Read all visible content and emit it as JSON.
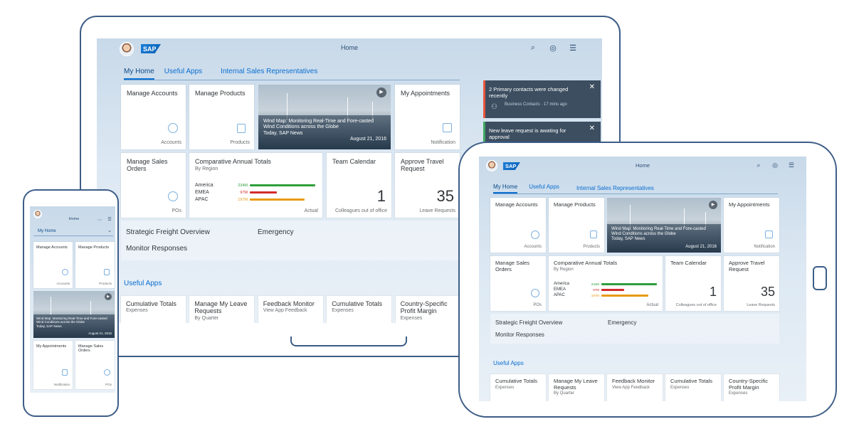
{
  "colors": {
    "accent": "#0a6ed1",
    "device_frame": "#3d5d87",
    "america": "#2f9e3b",
    "emea": "#d22b2b",
    "apac": "#e89a12"
  },
  "shell": {
    "title": "Home",
    "logo": "SAP",
    "search_icon": "search-icon",
    "copilot_icon": "copilot-icon",
    "menu_icon": "menu-icon"
  },
  "tabs": [
    "My Home",
    "Useful Apps",
    "Internal Sales Representatives"
  ],
  "tiles": {
    "manage_accounts": {
      "title": "Manage Accounts",
      "footer": "Accounts",
      "icon": "accounts-icon"
    },
    "manage_products": {
      "title": "Manage Products",
      "footer": "Products",
      "icon": "products-icon"
    },
    "news": {
      "headline": "Wind Map: Monitoring Real-Time and Fore-casted Wind Conditions across the Globe",
      "source": "Today, SAP News",
      "date": "August 21, 2016"
    },
    "my_appointments": {
      "title": "My Appointments",
      "footer": "Notification",
      "icon": "calendar-icon"
    },
    "manage_sales_orders": {
      "title": "Manage Sales Orders",
      "footer": "POs",
      "icon": "pos-icon"
    },
    "comparative": {
      "title": "Comparative Annual Totals",
      "subtitle": "By Region",
      "footer": "Actual"
    },
    "team_calendar": {
      "title": "Team Calendar",
      "number": "1",
      "footer": "Colleagues out of office"
    },
    "approve_travel": {
      "title": "Approve Travel Request",
      "number": "35",
      "footer": "Leave Requests"
    }
  },
  "chart_data": {
    "type": "bar",
    "title": "Comparative Annual Totals",
    "subtitle": "By Region",
    "categories": [
      "America",
      "EMEA",
      "APAC"
    ],
    "value_labels": [
      "234M",
      "97M",
      "197M"
    ],
    "values": [
      234,
      97,
      197
    ],
    "xlim": [
      0,
      240
    ]
  },
  "links": {
    "strategic_freight": "Strategic Freight Overview",
    "emergency": "Emergency",
    "monitor_responses": "Monitor Responses"
  },
  "useful_apps": {
    "title": "Useful Apps",
    "items": [
      {
        "title": "Cumulative Totals",
        "subtitle": "Expenses"
      },
      {
        "title": "Manage My Leave Requests",
        "subtitle": "By Quarter"
      },
      {
        "title": "Feedback Monitor",
        "subtitle": "View App Feedback"
      },
      {
        "title": "Cumulative Totals",
        "subtitle": "Expenses"
      },
      {
        "title": "Country-Specific Profit Margin",
        "subtitle": "Expenses"
      }
    ]
  },
  "notifications": [
    {
      "text": "2 Primary contacts were changed recently",
      "meta": "Business Contacts · 17 mins ago"
    },
    {
      "text": "New leave request is awating for approval"
    }
  ]
}
